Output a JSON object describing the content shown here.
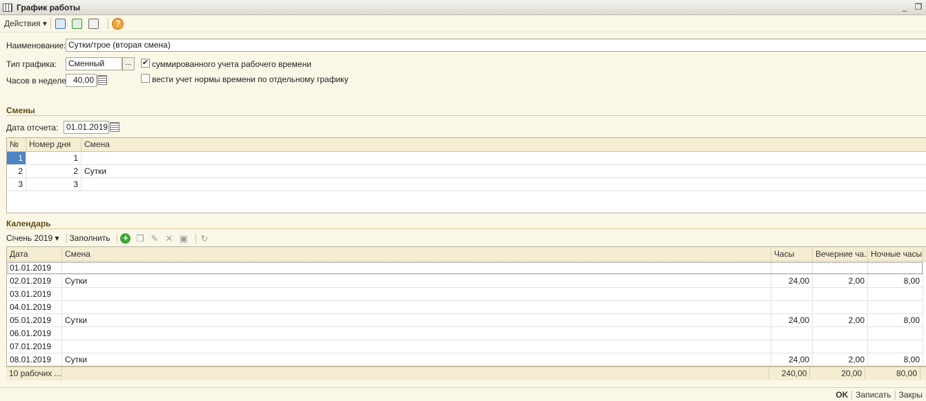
{
  "window": {
    "title": "График работы"
  },
  "toolbar": {
    "actions_label": "Действия"
  },
  "form": {
    "name_label": "Наименование:",
    "name_value": "Сутки/трое (вторая смена)",
    "type_label": "Тип графика:",
    "type_value": "Сменный",
    "hours_label": "Часов в неделе:",
    "hours_value": "40,00",
    "summarized_label": "суммированного учета рабочего времени",
    "summarized_checked": true,
    "separate_norm_label": "вести учет нормы времени по отдельному графику",
    "separate_norm_checked": false
  },
  "shifts": {
    "section_title": "Смены",
    "ref_date_label": "Дата отсчета:",
    "ref_date_value": "01.01.2019",
    "columns": {
      "num": "№",
      "day": "Номер дня",
      "shift": "Смена"
    },
    "rows": [
      {
        "num": "1",
        "day": "1",
        "shift": ""
      },
      {
        "num": "2",
        "day": "2",
        "shift": "Сутки"
      },
      {
        "num": "3",
        "day": "3",
        "shift": ""
      }
    ]
  },
  "calendar": {
    "section_title": "Календарь",
    "month_selector": "Січень 2019",
    "fill_label": "Заполнить",
    "columns": {
      "date": "Дата",
      "shift": "Смена",
      "hours": "Часы",
      "evening": "Вечерние ча...",
      "night": "Ночные часы"
    },
    "rows": [
      {
        "date": "01.01.2019",
        "shift": "",
        "hours": "",
        "evening": "",
        "night": ""
      },
      {
        "date": "02.01.2019",
        "shift": "Сутки",
        "hours": "24,00",
        "evening": "2,00",
        "night": "8,00"
      },
      {
        "date": "03.01.2019",
        "shift": "",
        "hours": "",
        "evening": "",
        "night": ""
      },
      {
        "date": "04.01.2019",
        "shift": "",
        "hours": "",
        "evening": "",
        "night": ""
      },
      {
        "date": "05.01.2019",
        "shift": "Сутки",
        "hours": "24,00",
        "evening": "2,00",
        "night": "8,00"
      },
      {
        "date": "06.01.2019",
        "shift": "",
        "hours": "",
        "evening": "",
        "night": ""
      },
      {
        "date": "07.01.2019",
        "shift": "",
        "hours": "",
        "evening": "",
        "night": ""
      },
      {
        "date": "08.01.2019",
        "shift": "Сутки",
        "hours": "24,00",
        "evening": "2,00",
        "night": "8,00"
      }
    ],
    "totals": {
      "date": "10 рабочих ...",
      "hours": "240,00",
      "evening": "20,00",
      "night": "80,00"
    }
  },
  "bottom": {
    "ok": "OK",
    "save": "Записать",
    "close": "Закры"
  }
}
